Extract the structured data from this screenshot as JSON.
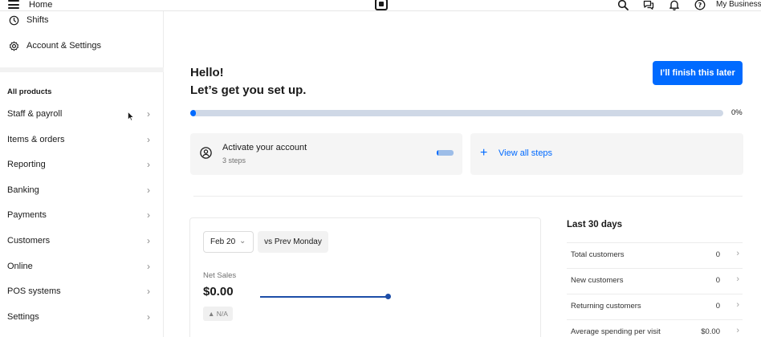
{
  "topbar": {
    "home_label": "Home",
    "business_label": "My Business",
    "icons": [
      "menu-icon",
      "square-logo-icon",
      "search-icon",
      "messages-icon",
      "bell-icon",
      "help-icon"
    ]
  },
  "sidebar": {
    "top_items": [
      {
        "label": "Shifts",
        "icon": "clock-icon"
      },
      {
        "label": "Account & Settings",
        "icon": "gear-icon"
      }
    ],
    "section_title": "All products",
    "items": [
      {
        "label": "Staff & payroll"
      },
      {
        "label": "Items & orders"
      },
      {
        "label": "Reporting"
      },
      {
        "label": "Banking"
      },
      {
        "label": "Payments"
      },
      {
        "label": "Customers"
      },
      {
        "label": "Online"
      },
      {
        "label": "POS systems"
      },
      {
        "label": "Settings"
      }
    ]
  },
  "main": {
    "greeting": "Hello!",
    "subgreeting": "Let’s get you set up.",
    "finish_button": "I’ll finish this later",
    "progress": {
      "value": 0.0,
      "label": "0%"
    },
    "activate": {
      "title": "Activate your account",
      "subtitle": "3 steps"
    },
    "view_steps": "View all steps",
    "sales": {
      "date": "Feb 20",
      "compare": "vs Prev Monday",
      "net_label": "Net Sales",
      "net_value": "$0.00",
      "change": "N/A"
    },
    "last30": {
      "title": "Last 30 days",
      "rows": [
        {
          "label": "Total customers",
          "value": "0"
        },
        {
          "label": "New customers",
          "value": "0"
        },
        {
          "label": "Returning customers",
          "value": "0"
        },
        {
          "label": "Average spending per visit",
          "value": "$0.00"
        }
      ]
    }
  },
  "colors": {
    "accent": "#006aff",
    "progress_track": "#cfd8e6",
    "chart_line": "#1d4ea8"
  }
}
